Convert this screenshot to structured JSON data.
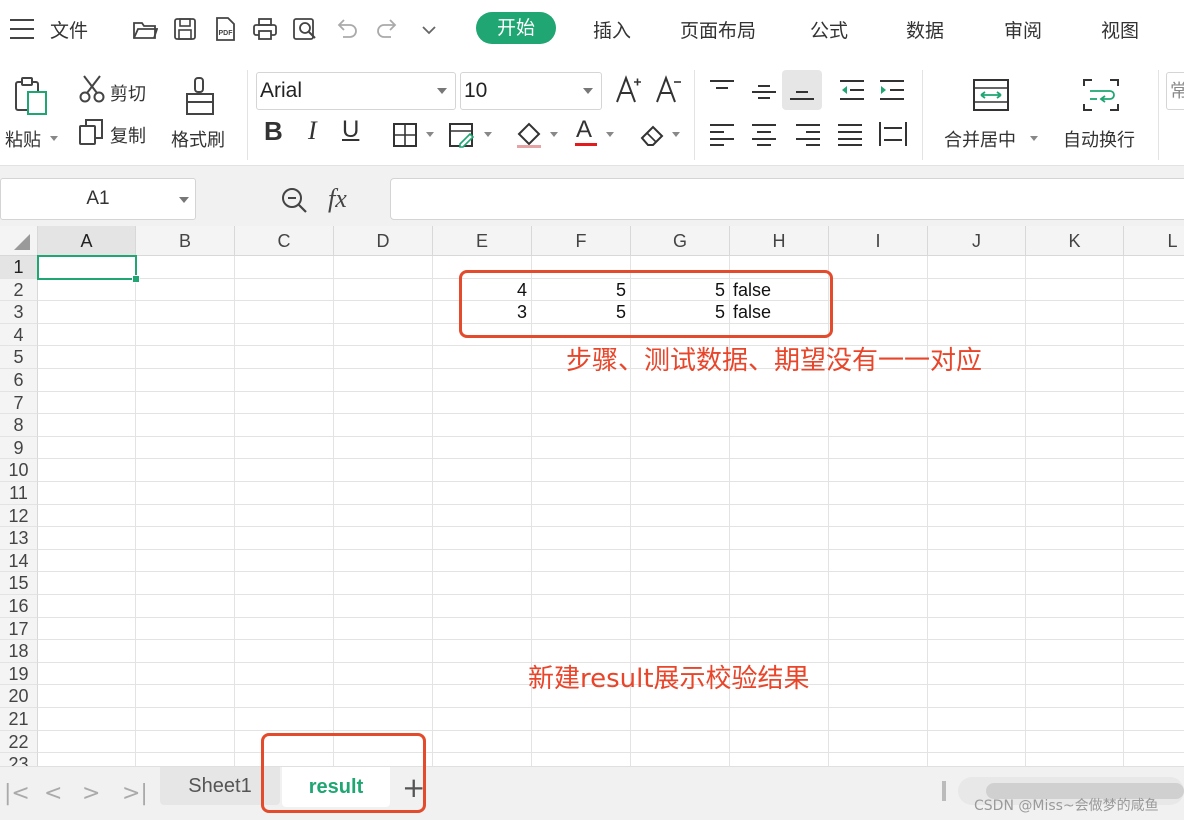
{
  "menubar": {
    "menu_icon": "hamburger-icon",
    "file_label": "文件",
    "quick_icons": [
      "open-folder-icon",
      "save-icon",
      "export-pdf-icon",
      "print-icon",
      "print-preview-icon",
      "undo-icon",
      "redo-icon",
      "more-dropdown-icon"
    ],
    "tabs": [
      {
        "label": "开始",
        "active": true
      },
      {
        "label": "插入"
      },
      {
        "label": "页面布局"
      },
      {
        "label": "公式"
      },
      {
        "label": "数据"
      },
      {
        "label": "审阅"
      },
      {
        "label": "视图"
      }
    ],
    "accent": "#1fa672"
  },
  "ribbon": {
    "paste_label": "粘贴",
    "cut_label": "剪切",
    "copy_label": "复制",
    "format_painter_label": "格式刷",
    "font_name": "Arial",
    "font_size": "10",
    "merge_label": "合并居中",
    "wrap_label": "自动换行",
    "number_format_partial": "常"
  },
  "formula_bar": {
    "name_box": "A1",
    "fx_label": "fx",
    "value": ""
  },
  "grid": {
    "columns": [
      "A",
      "B",
      "C",
      "D",
      "E",
      "F",
      "G",
      "H",
      "I",
      "J",
      "K",
      "L"
    ],
    "rows": [
      "1",
      "2",
      "3",
      "4",
      "5",
      "6",
      "7",
      "8",
      "9",
      "10",
      "11",
      "12",
      "13",
      "14",
      "15",
      "16",
      "17",
      "18",
      "19",
      "20",
      "21",
      "22",
      "23"
    ],
    "selected_cell": "A1",
    "cells": [
      {
        "ref": "E2",
        "value": "4"
      },
      {
        "ref": "F2",
        "value": "5"
      },
      {
        "ref": "G2",
        "value": "5"
      },
      {
        "ref": "H2",
        "value": "false"
      },
      {
        "ref": "E3",
        "value": "3"
      },
      {
        "ref": "F3",
        "value": "5"
      },
      {
        "ref": "G3",
        "value": "5"
      },
      {
        "ref": "H3",
        "value": "false"
      }
    ]
  },
  "annotations": {
    "note_top": "步骤、测试数据、期望没有一一对应",
    "note_bottom": "新建result展示校验结果",
    "color": "#e8452a"
  },
  "sheet_tabs": {
    "tabs": [
      {
        "label": "Sheet1",
        "active": false
      },
      {
        "label": "result",
        "active": true
      }
    ],
    "add_label": "+"
  },
  "watermark": "CSDN @Miss~会做梦的咸鱼"
}
